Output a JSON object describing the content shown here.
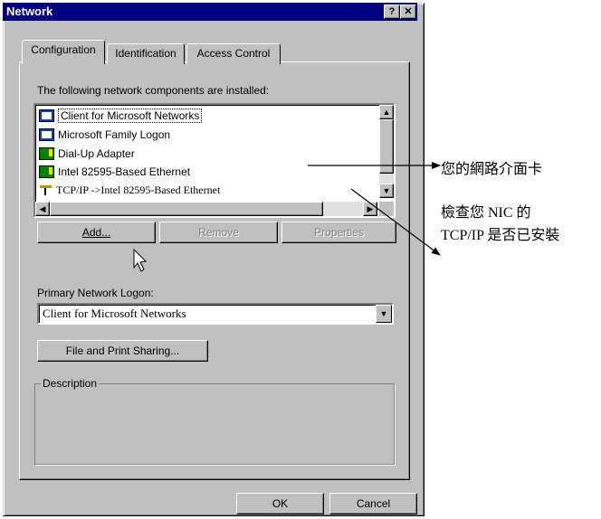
{
  "window": {
    "title": "Network",
    "help_glyph": "?",
    "close_glyph": "✕"
  },
  "tabs": [
    {
      "label": "Configuration",
      "selected": true
    },
    {
      "label": "Identification",
      "selected": false
    },
    {
      "label": "Access Control",
      "selected": false
    }
  ],
  "components": {
    "label": "The following network components are installed:",
    "items": [
      {
        "icon": "network-client-icon",
        "label": "Client for Microsoft Networks"
      },
      {
        "icon": "network-client-icon",
        "label": "Microsoft Family Logon"
      },
      {
        "icon": "network-adapter-icon",
        "label": "Dial-Up Adapter"
      },
      {
        "icon": "network-adapter-icon",
        "label": "Intel 82595-Based Ethernet"
      },
      {
        "icon": "protocol-icon",
        "label": "TCP/IP ->Intel 82595-Based Ethernet"
      }
    ]
  },
  "buttons": {
    "add": "Add...",
    "remove": "Remove",
    "properties": "Properties",
    "file_print": "File and Print Sharing...",
    "ok": "OK",
    "cancel": "Cancel"
  },
  "logon": {
    "label": "Primary Network Logon:",
    "value": "Client for Microsoft Networks"
  },
  "description": {
    "legend": "Description"
  },
  "annotations": {
    "nic": "您的網路介面卡",
    "check_line1": "檢查您 NIC  的",
    "check_line2": "TCP/IP 是否已安裝"
  }
}
